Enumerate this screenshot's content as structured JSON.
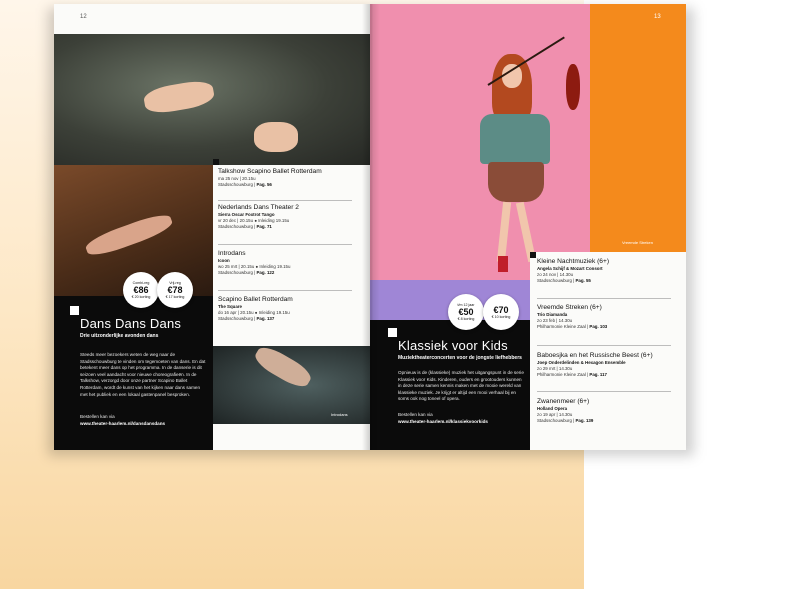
{
  "left_page": {
    "page_number": "12",
    "title": "Dans Dans Dans",
    "subtitle": "Drie uitzonderlijke avonden dans",
    "body": "Steeds meer bezoekers weten de weg naar de Stadsschouwburg te vinden om tegemoeten van dans. En dat betekent meer dans op het programma. In de danserie is dit seizoen veel aandacht voor nieuwe choreografieën. In de Talkshow, verzorgd door onze partner Scapino Ballet Rotterdam, wordt de kunst van het kijken naar dans samen met het publiek en een lokaal gastenpanel besproken.",
    "order_label": "Bestellen kan via",
    "order_url": "www.theater-haarlem.nl/dansdansdans",
    "bubbles": [
      {
        "label": "Combi-reg",
        "price": "€86",
        "discount": "€ 20 korting"
      },
      {
        "label": "Vrij-reg",
        "price": "€78",
        "discount": "€ 17 korting"
      }
    ],
    "events": [
      {
        "title": "Talkshow Scapino Ballet Rotterdam",
        "sub": "",
        "date": "ma 25 nov | 20.15u",
        "venue": "Stadsschouwburg",
        "page": "Pag. 56"
      },
      {
        "title": "Nederlands Dans Theater 2",
        "sub": "Sierra Oscar Foxtrot Tango",
        "date": "vr 20 dec | 20.15u",
        "intro": "Inleiding 19.15u",
        "venue": "Stadsschouwburg",
        "page": "Pag. 71"
      },
      {
        "title": "Introdans",
        "sub": "Icoon",
        "date": "wo 25 mrt | 20.15u",
        "intro": "Inleiding 19.15u",
        "venue": "Stadsschouwburg",
        "page": "Pag. 122"
      },
      {
        "title": "Scapino Ballet Rotterdam",
        "sub": "The Square",
        "date": "do 16 apr | 20.15u",
        "intro": "Inleiding 19.15u",
        "venue": "Stadsschouwburg",
        "page": "Pag. 137"
      }
    ],
    "photo_caption": "Introdans"
  },
  "right_page": {
    "page_number": "13",
    "title": "Klassiek voor Kids",
    "subtitle": "Muziektheaterconcerten voor de jongste liefhebbers",
    "body": "Opnieuw is de (klassieke) muziek het uitgangspunt in de serie Klassiek voor Kids. Kinderen, ouders en grootouders kunnen in deze serie samen kennis maken met de mooie wereld van klassieke muziek. Je krijgt er altijd een mooi verhaal bij en soms ook nog toneel of opera.",
    "order_label": "Bestellen kan via",
    "order_url": "www.theater-haarlem.nl/klassiekvoorkids",
    "bubbles": [
      {
        "label": "t/m 12 jaar",
        "price": "€50",
        "discount": "€ 8 korting"
      },
      {
        "label": "",
        "price": "€70",
        "discount": "€ 10 korting"
      }
    ],
    "photo_caption": "Vreemde Streken",
    "events": [
      {
        "title": "Kleine Nachtmuziek (6+)",
        "sub": "Angela Schijf & Mozart Consort",
        "date": "zo 24 nov | 14.30u",
        "venue": "Stadsschouwburg",
        "page": "Pag. 55"
      },
      {
        "title": "Vreemde Streken (6+)",
        "sub": "Trio Diamanda",
        "date": "zo 23 feb | 14.30u",
        "venue": "Philharmonie Kleine Zaal",
        "page": "Pag. 103"
      },
      {
        "title": "Baboesjka en het Russische Beest (6+)",
        "sub": "Joep Onderdelinden & Hexagon Ensemble",
        "date": "zo 29 mrt | 14.30u",
        "venue": "Philharmonie Kleine Zaal",
        "page": "Pag. 117"
      },
      {
        "title": "Zwanenmeer (6+)",
        "sub": "Holland Opera",
        "date": "zo 19 apr | 14.30u",
        "venue": "Stadsschouwburg",
        "page": "Pag. 139"
      }
    ]
  },
  "colors": {
    "pink": "#f08fae",
    "orange": "#f48a1c",
    "lilac": "#c9b3e8",
    "black": "#0b0b0b",
    "peach": "#fde7c4"
  }
}
